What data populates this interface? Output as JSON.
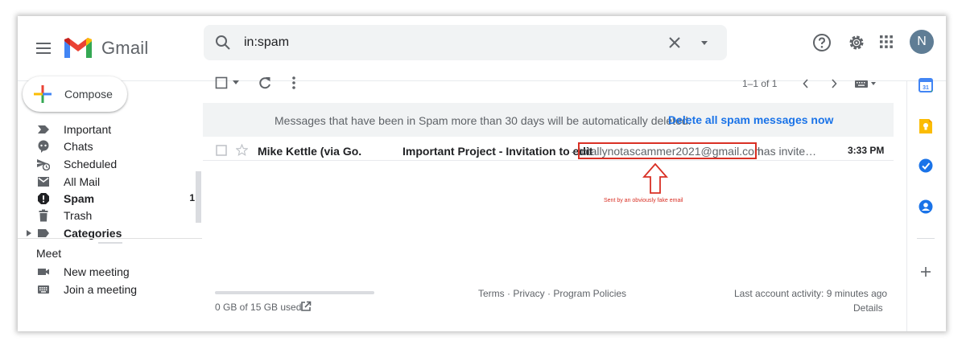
{
  "header": {
    "brand": "Gmail",
    "search_query": "in:spam",
    "avatar_letter": "N"
  },
  "compose": {
    "label": "Compose"
  },
  "sidebar": {
    "items": [
      {
        "label": "Important",
        "icon": "important-icon",
        "bold": false,
        "count": ""
      },
      {
        "label": "Chats",
        "icon": "chat-icon",
        "bold": false,
        "count": ""
      },
      {
        "label": "Scheduled",
        "icon": "scheduled-icon",
        "bold": false,
        "count": ""
      },
      {
        "label": "All Mail",
        "icon": "all-mail-icon",
        "bold": false,
        "count": ""
      },
      {
        "label": "Spam",
        "icon": "spam-icon",
        "bold": true,
        "count": "1"
      },
      {
        "label": "Trash",
        "icon": "trash-icon",
        "bold": false,
        "count": ""
      },
      {
        "label": "Categories",
        "icon": "label-icon",
        "bold": true,
        "count": ""
      }
    ],
    "meet": {
      "label": "Meet",
      "items": [
        {
          "label": "New meeting",
          "icon": "video-camera-icon"
        },
        {
          "label": "Join a meeting",
          "icon": "keyboard-icon"
        }
      ]
    }
  },
  "toolbar": {
    "pagination": "1–1 of 1"
  },
  "banner": {
    "text": "Messages that have been in Spam more than 30 days will be automatically deleted.",
    "link": "Delete all spam messages now"
  },
  "emails": [
    {
      "sender": "Mike Kettle (via Go.",
      "subject": "Important Project - Invitation to edit",
      "snippet_prefix": "-",
      "snippet_email": "totallynotascammer2021@gmail.com",
      "snippet_suffix": "has invite…",
      "time": "3:33 PM"
    }
  ],
  "annotation": {
    "text": "Sent by an obviously fake email",
    "color": "#d93025"
  },
  "footer": {
    "storage": "0 GB of 15 GB used",
    "links": "Terms · Privacy · Program Policies",
    "activity": "Last account activity: 9 minutes ago",
    "details": "Details"
  },
  "colors": {
    "accent_blue": "#1a73e8",
    "annotation_red": "#d93025",
    "avatar_bg": "#5f7d95"
  }
}
